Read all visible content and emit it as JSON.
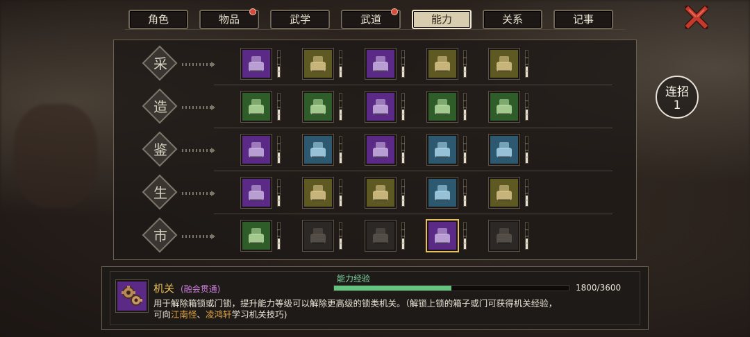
{
  "tabs": [
    {
      "label": "角色",
      "active": false,
      "badge": false
    },
    {
      "label": "物品",
      "active": false,
      "badge": true
    },
    {
      "label": "武学",
      "active": false,
      "badge": false
    },
    {
      "label": "武道",
      "active": false,
      "badge": true
    },
    {
      "label": "能力",
      "active": true,
      "badge": false
    },
    {
      "label": "关系",
      "active": false,
      "badge": false
    },
    {
      "label": "记事",
      "active": false,
      "badge": false
    }
  ],
  "categories": [
    {
      "label": "采",
      "skills": [
        {
          "icon": "pickaxe-ore-icon",
          "tier": "purple",
          "level": 0.4
        },
        {
          "icon": "axe-log-icon",
          "tier": "olive",
          "level": 0.4
        },
        {
          "icon": "herb-basket-icon",
          "tier": "purple",
          "level": 0.4
        },
        {
          "icon": "fishing-rod-icon",
          "tier": "olive",
          "level": 0.4
        },
        {
          "icon": "silk-knitting-icon",
          "tier": "olive",
          "level": 0.4
        }
      ]
    },
    {
      "label": "造",
      "skills": [
        {
          "icon": "anvil-hammer-icon",
          "tier": "green",
          "level": 0.4
        },
        {
          "icon": "tailoring-robe-icon",
          "tier": "green",
          "level": 0.4
        },
        {
          "icon": "knife-herbs-icon",
          "tier": "purple",
          "level": 0.4
        },
        {
          "icon": "medicine-stove-icon",
          "tier": "green",
          "level": 0.4
        },
        {
          "icon": "gem-crafting-icon",
          "tier": "green",
          "level": 0.4
        }
      ]
    },
    {
      "label": "鉴",
      "skills": [
        {
          "icon": "scroll-magnifier-icon",
          "tier": "purple",
          "level": 0.4
        },
        {
          "icon": "book-magnifier-icon",
          "tier": "blue",
          "level": 0.4
        },
        {
          "icon": "table-magnifier-icon",
          "tier": "purple",
          "level": 0.4
        },
        {
          "icon": "compass-magnifier-icon",
          "tier": "blue",
          "level": 0.4
        },
        {
          "icon": "box-magnifier-icon",
          "tier": "blue",
          "level": 0.4
        }
      ]
    },
    {
      "label": "生",
      "skills": [
        {
          "icon": "drum-icon",
          "tier": "purple",
          "level": 0.4
        },
        {
          "icon": "chocolate-bar-icon",
          "tier": "olive",
          "level": 0.4
        },
        {
          "icon": "cooking-pot-icon",
          "tier": "olive",
          "level": 0.4
        },
        {
          "icon": "map-scroll-icon",
          "tier": "blue",
          "level": 0.4
        },
        {
          "icon": "whip-coil-icon",
          "tier": "olive",
          "level": 0.4
        }
      ]
    },
    {
      "label": "市",
      "skills": [
        {
          "icon": "money-bag-icon",
          "tier": "green",
          "level": 0.4
        },
        {
          "icon": "glove-icon",
          "tier": "dark",
          "level": 0.4
        },
        {
          "icon": "bowl-icon",
          "tier": "dark",
          "level": 0.4
        },
        {
          "icon": "gears-mechanism-icon",
          "tier": "purple",
          "level": 0.4,
          "selected": true
        },
        {
          "icon": "horn-icon",
          "tier": "dark",
          "level": 0.4
        }
      ]
    }
  ],
  "combo": {
    "label": "连招",
    "count": "1"
  },
  "detail": {
    "icon": "gears-mechanism-icon",
    "name": "机关",
    "rank": "(融会贯通)",
    "xp_label": "能力经验",
    "xp_current": 1800,
    "xp_max": 3600,
    "xp_text": "1800/3600",
    "desc_main": "用于解除箱锁或门锁，提升能力等级可以解除更高级的锁类机关。（解锁上锁的箱子或门可获得机关经验，",
    "desc_prefix": "可向",
    "npc1": "江南怪",
    "sep": "、",
    "npc2": "凌鸿轩",
    "desc_suffix": "学习机关技巧)"
  },
  "colors": {
    "accent": "#e8c060",
    "xp": "#63c47f",
    "npc": "#e0a548",
    "rank": "#c97bd8"
  }
}
